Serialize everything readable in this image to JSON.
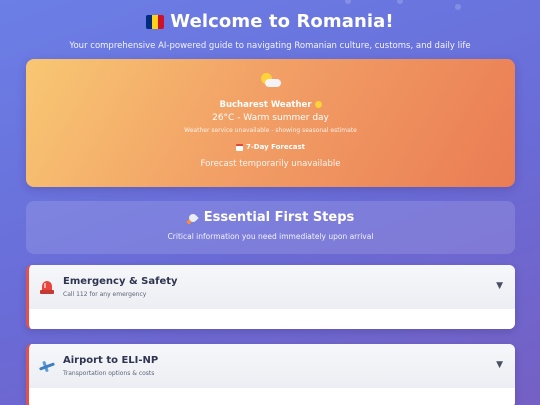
{
  "header": {
    "title": "Welcome to Romania!",
    "subtitle": "Your comprehensive AI-powered guide to navigating Romanian culture, customs, and daily life",
    "flag_colors": [
      "#002B7F",
      "#FCD116",
      "#CE1126"
    ]
  },
  "weather": {
    "icon": "sun-behind-cloud-icon",
    "city_label": "Bucharest Weather",
    "temperature_text": "26°C - Warm summer day",
    "note": "Weather service unavailable - showing seasonal estimate",
    "forecast_label": "7-Day Forecast",
    "forecast_status": "Forecast temporarily unavailable"
  },
  "first_steps": {
    "title": "Essential First Steps",
    "subtitle": "Critical information you need immediately upon arrival"
  },
  "cards": [
    {
      "icon": "siren-icon",
      "title": "Emergency & Safety",
      "subtitle": "Call 112 for any emergency"
    },
    {
      "icon": "airplane-icon",
      "title": "Airport to ELI-NP",
      "subtitle": "Transportation options & costs"
    }
  ],
  "colors": {
    "accent_red": "#e4514d",
    "weather_gradient_start": "#f8c773",
    "weather_gradient_end": "#ea7c54"
  }
}
